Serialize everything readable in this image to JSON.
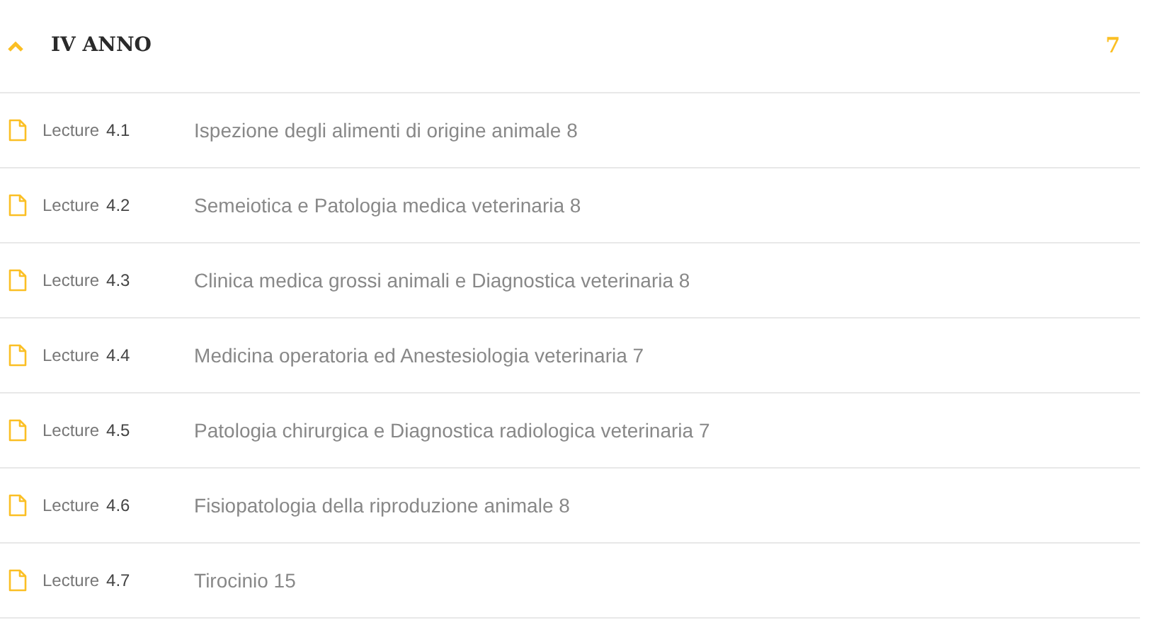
{
  "section": {
    "title": "IV ANNO",
    "count": "7",
    "expanded": true,
    "lessons": [
      {
        "label": "Lecture",
        "number": "4.1",
        "title": "Ispezione degli alimenti di origine animale 8"
      },
      {
        "label": "Lecture",
        "number": "4.2",
        "title": "Semeiotica e Patologia medica veterinaria 8"
      },
      {
        "label": "Lecture",
        "number": "4.3",
        "title": "Clinica medica grossi animali e Diagnostica veterinaria 8"
      },
      {
        "label": "Lecture",
        "number": "4.4",
        "title": "Medicina operatoria ed Anestesiologia veterinaria 7"
      },
      {
        "label": "Lecture",
        "number": "4.5",
        "title": "Patologia chirurgica e Diagnostica radiologica veterinaria 7"
      },
      {
        "label": "Lecture",
        "number": "4.6",
        "title": "Fisiopatologia della riproduzione animale 8"
      },
      {
        "label": "Lecture",
        "number": "4.7",
        "title": "Tirocinio 15"
      }
    ]
  }
}
